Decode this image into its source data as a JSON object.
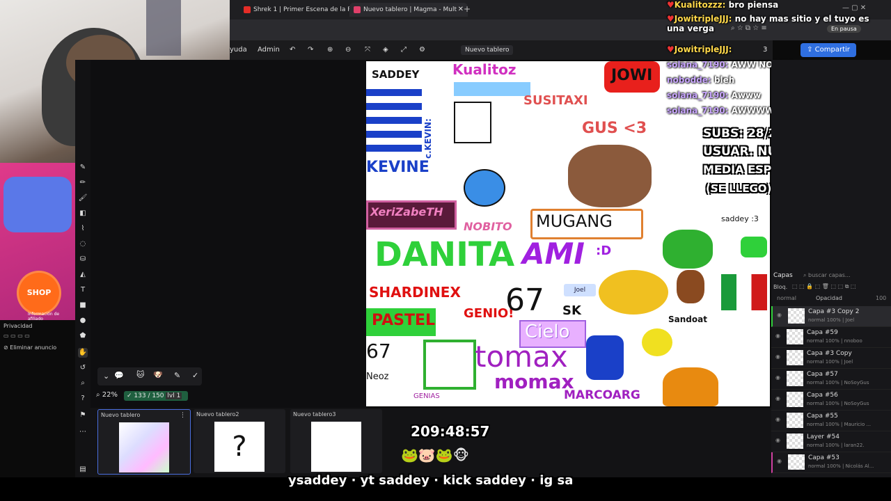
{
  "tabs": [
    {
      "label": "Shrek 1 | Primer Escena de la Pe",
      "color": "#e52d27"
    },
    {
      "label": "Nuevo tablero | Magma - Mult",
      "color": "#e0406a"
    }
  ],
  "toolbar": {
    "menu_ayuda": "yuda",
    "admin": "Admin",
    "board_name": "Nuevo tablero",
    "share_label": "Compartir",
    "viewer_count": "3",
    "paused_label": "En pausa"
  },
  "chat": [
    {
      "user": "Kualitozzz:",
      "msg": "bro piensa"
    },
    {
      "user": "JowitripleJJJ:",
      "msg": "no hay mas sitio y el tuyo es una verga"
    },
    {
      "user": "JowitripleJJJ:",
      "msg": ""
    }
  ],
  "system_msgs": [
    {
      "user": "solana_7190:",
      "msg": "AWW NOBITO"
    },
    {
      "user": "nobodde:",
      "msg": "bleh"
    },
    {
      "user": "solana_7190:",
      "msg": "Awww"
    },
    {
      "user": "solana_7190:",
      "msg": "AWWWW"
    }
  ],
  "stream_overlay": {
    "subs": "SUBS: 28/25",
    "new_users": "USUAR. NUEVOS: 250/250",
    "avg_viewers": "MEDIA ESPECT.: 75/75",
    "note": "(SE LLEGO) LOS QUIERO)",
    "timer": "209:48:57",
    "ticker": "ysaddey · yt saddey · kick saddey · ig sa"
  },
  "color_picker": {
    "hex": "ffffff",
    "accent": "#e63b3b"
  },
  "layers_panel": {
    "title": "Capas",
    "search_placeholder": "buscar capas...",
    "lock_label": "Bloq.",
    "blend": "normal",
    "opacity_label": "Opacidad",
    "opacity_value": "100",
    "layers": [
      {
        "name": "Capa #3 Copy 2",
        "sub": "normal 100% | Joel"
      },
      {
        "name": "Capa #59",
        "sub": "normal 100% | nnoboo"
      },
      {
        "name": "Capa #3 Copy",
        "sub": "normal 100% | Joel"
      },
      {
        "name": "Capa #57",
        "sub": "normal 100% | NoSoyGus"
      },
      {
        "name": "Capa #56",
        "sub": "normal 100% | NoSoyGus"
      },
      {
        "name": "Capa #55",
        "sub": "normal 100% | Mauricio ..."
      },
      {
        "name": "Layer #54",
        "sub": "normal 100% | laran22."
      },
      {
        "name": "Capa #53",
        "sub": "normal 100% | Nicolás Al..."
      }
    ]
  },
  "zoom": {
    "value": "22%",
    "users": "133 / 150",
    "level": "lvl 1"
  },
  "boards": [
    {
      "label": "Nuevo tablero"
    },
    {
      "label": "Nuevo tablero2"
    },
    {
      "label": "Nuevo tablero3"
    }
  ],
  "ad": {
    "button": "SHOP NOW",
    "note": "Información de afiliado"
  },
  "privacy": {
    "title": "Privacidad",
    "remove_ads": "Eliminar anuncio"
  },
  "canvas_art": {
    "saddey": "SADDEY",
    "kualitoz": "Kualitoz",
    "jowi": "JOWI",
    "kevine": "KEVINE",
    "kevine_side": "c.KEVIN:",
    "susitax": "SUSITAXI",
    "gus": "GUS <3",
    "xerizabeth": "XeriZabeTH",
    "nobito": "NOBITO",
    "mugang": "MUGANG",
    "danita": "DANITA",
    "ami": "AMI",
    "ami_face": ":D",
    "shardinex": "SHARDINEX",
    "genio": "GENIO!",
    "pastel": "PASTEL",
    "num67": "67",
    "sk": "SK",
    "joel": "Joel",
    "sandoat": "Sandoat",
    "cielo": "Cielo",
    "tomax": "tomax",
    "momax": "momax",
    "neoz": "Neoz",
    "marcoarg": "MARCOARG",
    "saddey3": "saddey :3",
    "genias": "GENIAS"
  }
}
